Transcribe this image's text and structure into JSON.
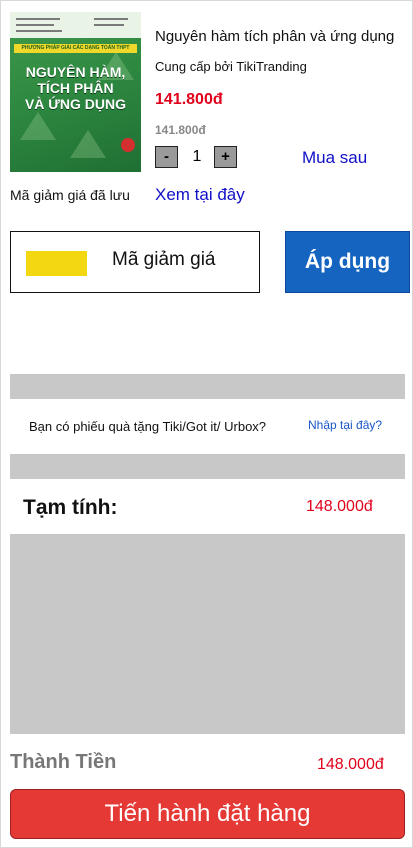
{
  "product": {
    "cover": {
      "band_text": "PHƯƠNG PHÁP GIẢI CÁC DẠNG TOÁN THPT",
      "title_lines": [
        "NGUYÊN HÀM,",
        "TÍCH PHÂN",
        "VÀ ỨNG DỤNG"
      ]
    },
    "title": "Nguyên hàm tích phân và ứng dụng",
    "seller": "Cung cấp bởi TikiTranding",
    "price": "141.800đ",
    "old_price": "141.800đ",
    "quantity": {
      "minus_label": "-",
      "value": "1",
      "plus_label": "+"
    },
    "save_later_label": "Mua sau"
  },
  "saved_coupons": {
    "label": "Mã giảm giá đã lưu",
    "link": "Xem tại đây"
  },
  "coupon": {
    "label": "Mã giảm giá",
    "apply_label": "Áp dụng"
  },
  "gift": {
    "question": "Bạn có phiếu quà tặng Tiki/Got it/ Urbox?",
    "link": "Nhập tại đây?"
  },
  "subtotal": {
    "label": "Tạm tính:",
    "value": "148.000đ"
  },
  "total": {
    "label": "Thành Tiền",
    "value": "148.000đ"
  },
  "checkout_label": "Tiến hành đặt hàng",
  "colors": {
    "price_red": "#e0001b",
    "link_blue": "#1010c8",
    "apply_blue": "#1565c0",
    "checkout_red": "#e53935",
    "placeholder_gray": "#c8c8c8",
    "coupon_yellow": "#f3d811"
  }
}
